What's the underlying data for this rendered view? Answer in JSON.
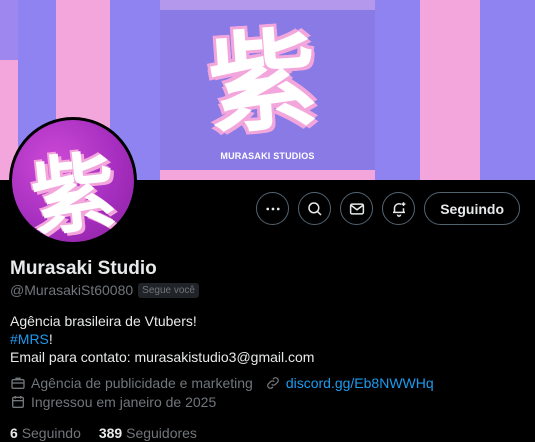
{
  "banner": {
    "brand_kanji": "紫",
    "studio_label": "MURASAKI STUDIOS"
  },
  "avatar": {
    "kanji": "紫"
  },
  "actions": {
    "more_icon": "more-horizontal-icon",
    "search_icon": "search-icon",
    "message_icon": "envelope-icon",
    "notify_icon": "bell-plus-icon",
    "follow_label": "Seguindo"
  },
  "profile": {
    "display_name": "Murasaki Studio",
    "handle": "@MurasakiSt60080",
    "follows_you": "Segue você",
    "bio_line1": "Agência brasileira de Vtubers!",
    "hashtag": "#MRS",
    "bio_line2_suffix": "!",
    "bio_line3": "Email para contato: murasakistudio3@gmail.com",
    "category": "Agência de publicidade e marketing",
    "link": "discord.gg/Eb8NWWHq",
    "joined": "Ingressou em janeiro de 2025"
  },
  "stats": {
    "following_count": "6",
    "following_label": "Seguindo",
    "followers_count": "389",
    "followers_label": "Seguidores"
  },
  "colors": {
    "accent": "#1d9bf0",
    "muted": "#71767b",
    "text": "#e7e9ea",
    "pink": "#f3a6dc",
    "violet": "#8f83f2",
    "purple": "#a72fc0"
  }
}
